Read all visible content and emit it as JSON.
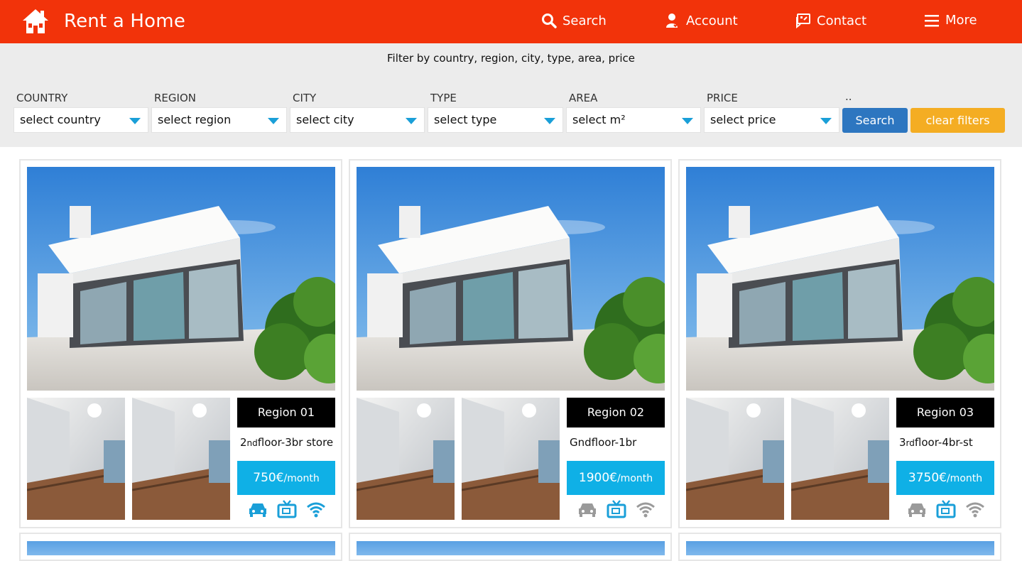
{
  "header": {
    "brand": "Rent a Home",
    "nav": [
      {
        "label": "Search",
        "icon": "search-icon"
      },
      {
        "label": "Account",
        "icon": "user-icon"
      },
      {
        "label": "Contact",
        "icon": "contact-icon"
      },
      {
        "label": "More",
        "icon": "menu-icon"
      }
    ]
  },
  "filters": {
    "title": "Filter by country, region, city, type, area, price",
    "fields": [
      {
        "label": "COUNTRY",
        "value": "select country"
      },
      {
        "label": "REGION",
        "value": "select region"
      },
      {
        "label": "CITY",
        "value": "select city"
      },
      {
        "label": "TYPE",
        "value": "select type"
      },
      {
        "label": "AREA",
        "value": "select m²"
      },
      {
        "label": "PRICE",
        "value": "select price"
      }
    ],
    "extra_label": "..",
    "search_label": "Search",
    "clear_label": "clear filters"
  },
  "listings": [
    {
      "region": "Region 01",
      "desc_pre": "2",
      "desc_sup": "nd",
      "desc_post": "floor-3br store",
      "price": "750€",
      "per": "/month",
      "amenities": {
        "parking": true,
        "tv": true,
        "wifi": true
      }
    },
    {
      "region": "Region 02",
      "desc_pre": "Gndfloor-1br",
      "desc_sup": "",
      "desc_post": "",
      "price": "1900€",
      "per": "/month",
      "amenities": {
        "parking": false,
        "tv": true,
        "wifi": false
      }
    },
    {
      "region": "Region 03",
      "desc_pre": "3",
      "desc_sup": "rd",
      "desc_post": "floor-4br-st",
      "price": "3750€",
      "per": "/month",
      "amenities": {
        "parking": false,
        "tv": true,
        "wifi": false
      }
    }
  ],
  "colors": {
    "brand": "#f2330a",
    "price": "#0fb0e6",
    "search_btn": "#2d76c0",
    "clear_btn": "#f4ad23",
    "amenity_on": "#1a9fd8",
    "amenity_off": "#9a9a9a"
  }
}
